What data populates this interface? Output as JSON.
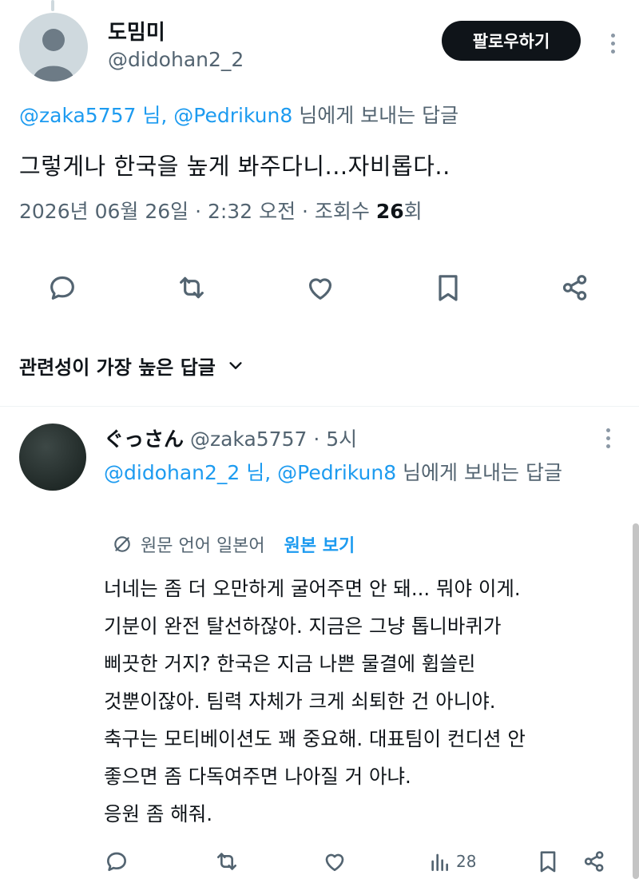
{
  "tweet": {
    "author_name": "도밈미",
    "author_handle": "@didohan2_2",
    "follow_label": "팔로우하기",
    "reply_to_mention1": "@zaka5757 님, @Pedrikun8",
    "reply_to_suffix": "님에게 보내는 답글",
    "text": "그렇게나 한국을 높게 봐주다니...자비롭다..",
    "meta_prefix": "2026년 06월 26일 · 2:32 오전 · 조회수",
    "meta_views": "26",
    "meta_suffix": "회"
  },
  "icons": {
    "reply": "reply-icon",
    "retweet": "retweet-icon",
    "like": "like-icon",
    "bookmark": "bookmark-icon",
    "share": "share-icon",
    "views": "views-icon"
  },
  "sort": {
    "label": "관련성이 가장 높은 답글"
  },
  "reply": {
    "author_name": "ぐっさん",
    "author_handle": "@zaka5757 · 5시",
    "reply_to_mention": "@didohan2_2 님, @Pedrikun8",
    "reply_to_suffix": " 님에게 보내는 답글",
    "translate_text": "원문 언어 일본어",
    "translate_link": "원본 보기",
    "body_lines": [
      "너네는 좀 더 오만하게 굴어주면 안 돼... 뭐야 이게.",
      "기분이 완전 탈선하잖아. 지금은 그냥 톱니바퀴가",
      "삐끗한 거지? 한국은 지금 나쁜 물결에 휩쓸린",
      "것뿐이잖아. 팀력 자체가 크게 쇠퇴한 건 아니야.",
      "축구는 모티베이션도 꽤 중요해. 대표팀이 컨디션 안",
      "좋으면 좀 다독여주면 나아질 거 아냐.",
      "응원 좀 해줘."
    ],
    "views_count": "28"
  },
  "colors": {
    "accent": "#1d9bf0",
    "text": "#0f1419",
    "secondary": "#536471"
  }
}
